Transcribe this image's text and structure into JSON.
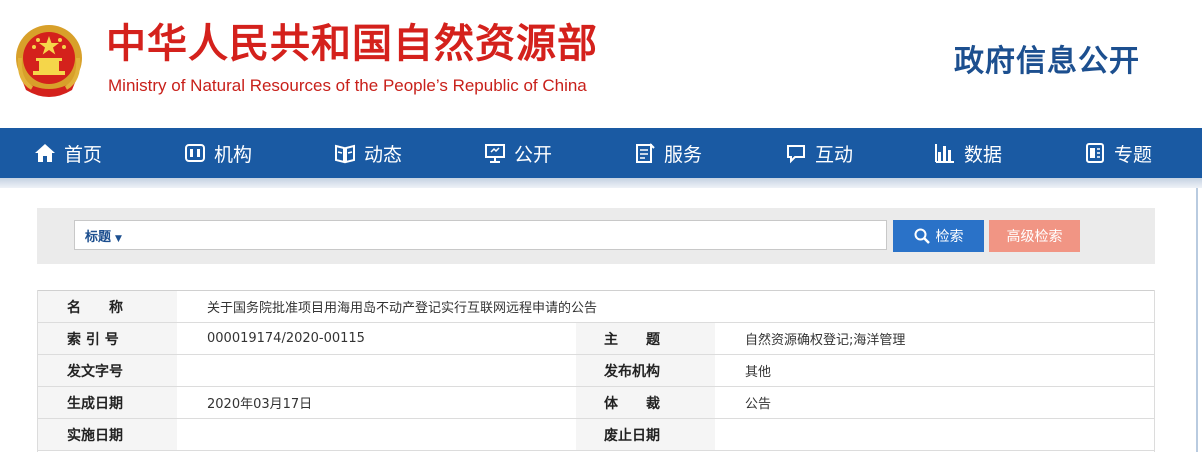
{
  "header": {
    "title_cn": "中华人民共和国自然资源部",
    "title_en": "Ministry of Natural Resources of the People’s Republic of China",
    "section": "政府信息公开",
    "emblem_icon": "national-emblem-icon"
  },
  "nav": {
    "items": [
      {
        "label": "首页",
        "icon": "home-icon"
      },
      {
        "label": "机构",
        "icon": "organization-icon"
      },
      {
        "label": "动态",
        "icon": "news-icon"
      },
      {
        "label": "公开",
        "icon": "disclosure-icon"
      },
      {
        "label": "服务",
        "icon": "service-icon"
      },
      {
        "label": "互动",
        "icon": "chat-icon"
      },
      {
        "label": "数据",
        "icon": "bar-chart-icon"
      },
      {
        "label": "专题",
        "icon": "topic-icon"
      }
    ],
    "bg_color": "#1a5aa3"
  },
  "search": {
    "type_label": "标题",
    "query": "",
    "search_label": "检索",
    "advanced_label": "高级检索"
  },
  "info": {
    "name_label": "名　　称",
    "name_value": "关于国务院批准项目用海用岛不动产登记实行互联网远程申请的公告",
    "index_label": "索 引 号",
    "index_value": "000019174/2020-00115",
    "subject_label": "主　　题",
    "subject_value": "自然资源确权登记;海洋管理",
    "docno_label": "发文字号",
    "docno_value": "",
    "publisher_label": "发布机构",
    "publisher_value": "其他",
    "date_label": "生成日期",
    "date_value": "2020年03月17日",
    "genre_label": "体　　裁",
    "genre_value": "公告",
    "effective_label": "实施日期",
    "effective_value": "",
    "expire_label": "废止日期",
    "expire_value": ""
  }
}
